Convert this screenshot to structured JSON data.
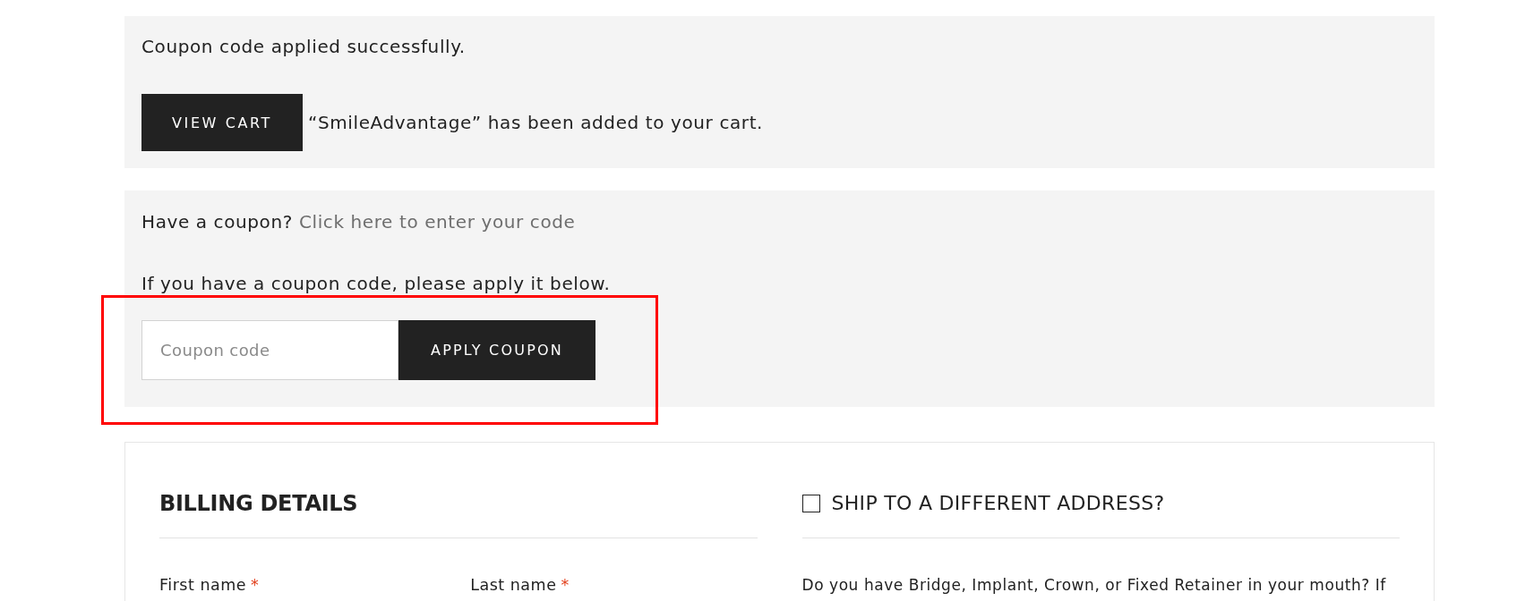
{
  "notices": [
    {
      "kind": "message",
      "text": "Coupon code applied successfully."
    },
    {
      "kind": "cart",
      "button": "VIEW CART",
      "text": "“SmileAdvantage” has been added to your cart."
    }
  ],
  "coupon": {
    "prompt": "Have a coupon?",
    "link": "Click here to enter your code",
    "instruction": "If you have a coupon code, please apply it below.",
    "input": {
      "placeholder": "Coupon code"
    },
    "button": "APPLY COUPON",
    "highlighted": true
  },
  "billing": {
    "title": "BILLING DETAILS",
    "fields": [
      {
        "label": "First name",
        "required": "*"
      },
      {
        "label": "Last name",
        "required": "*"
      }
    ]
  },
  "shipping": {
    "title": "SHIP TO A DIFFERENT ADDRESS?",
    "checked": false,
    "note": "Do you have Bridge, Implant, Crown, or Fixed Retainer in your mouth? If"
  }
}
